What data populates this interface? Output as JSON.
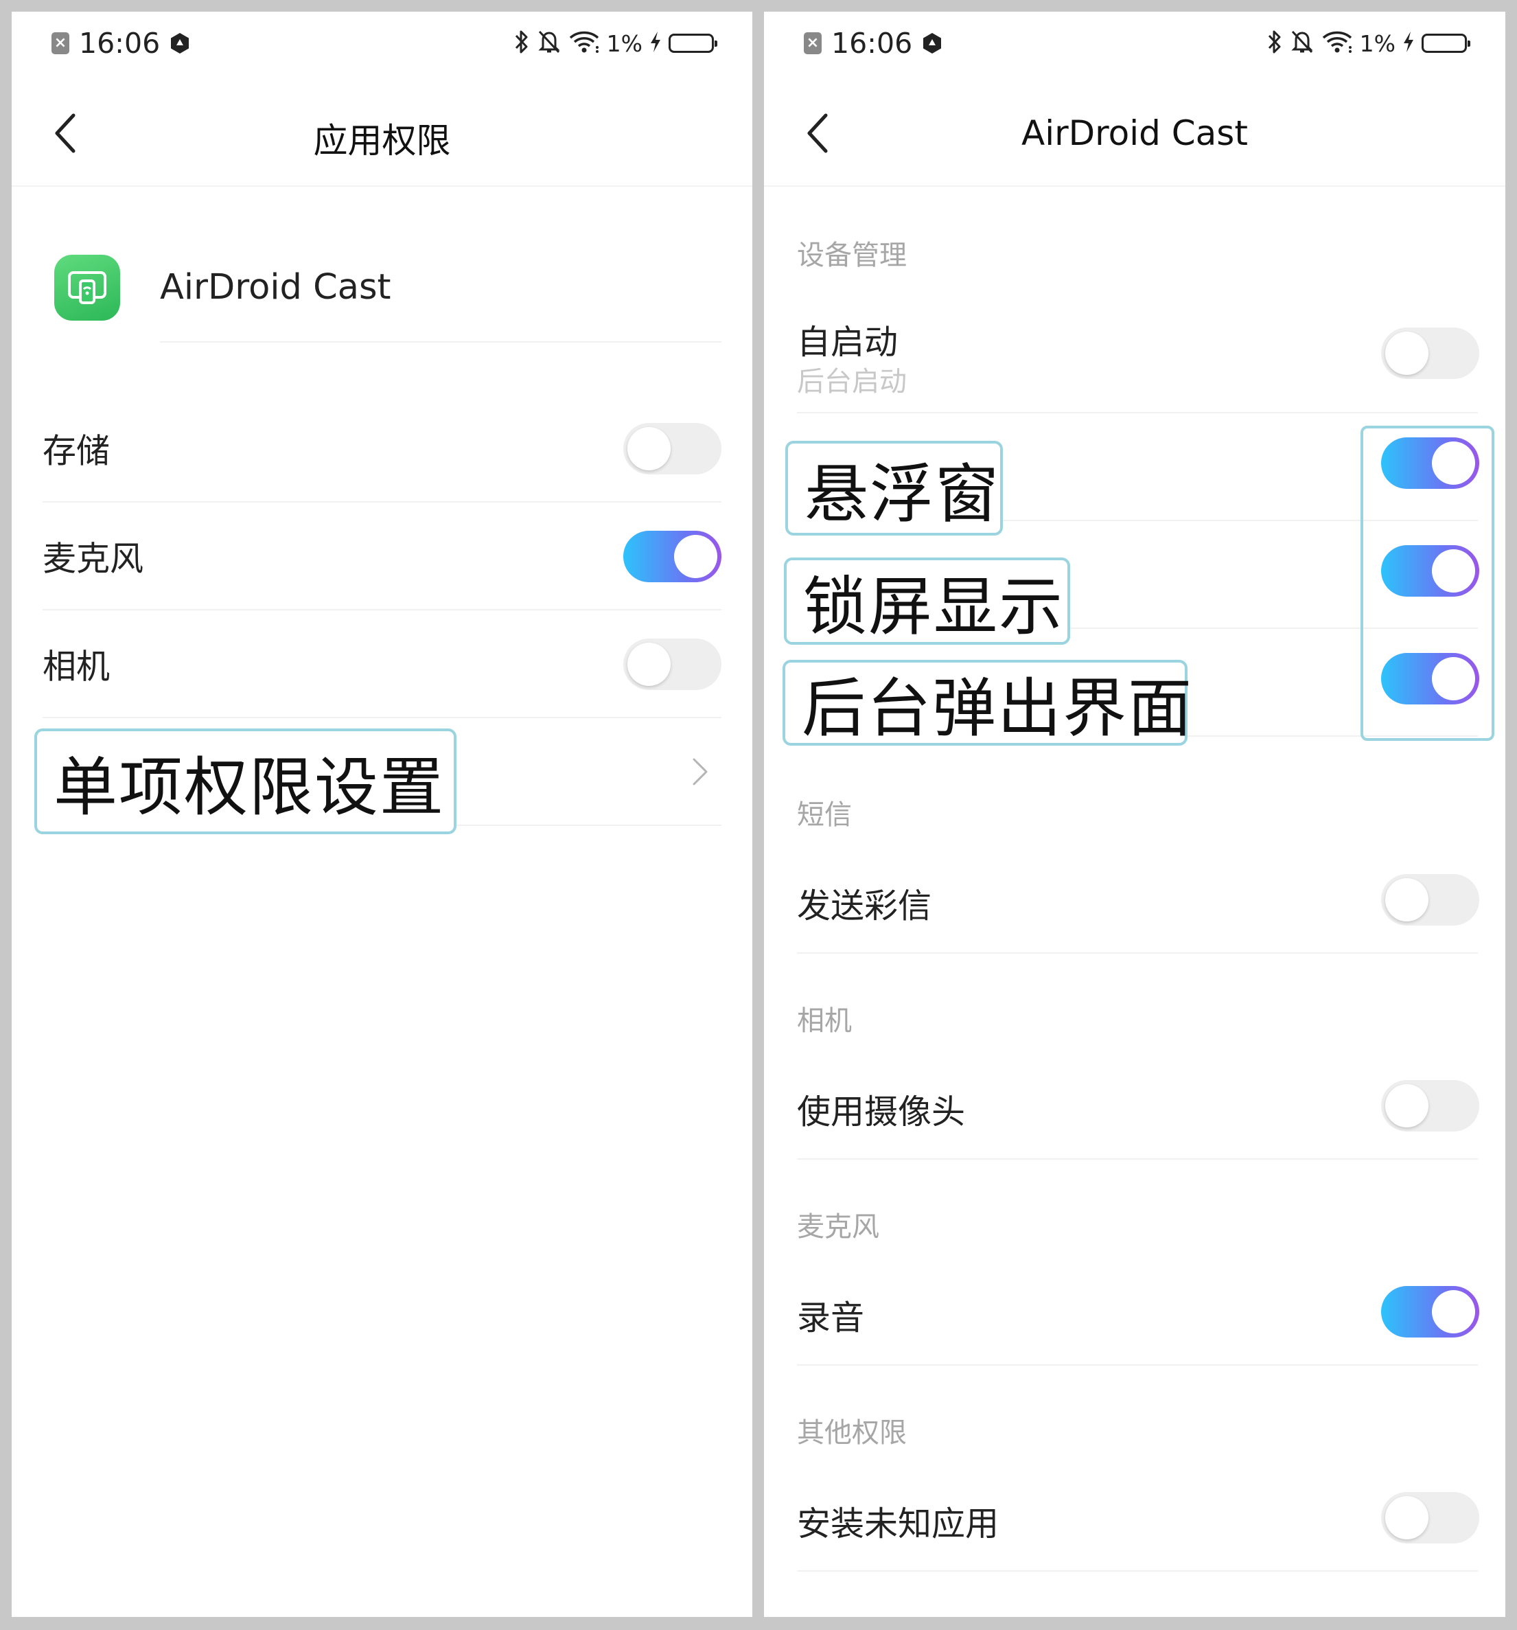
{
  "colors": {
    "toggle_on_gradient": [
      "#2dc3fb",
      "#6b75f4",
      "#9a56ea"
    ],
    "toggle_off": "#eeeeee",
    "callout_border": "#9ad4e0",
    "app_icon": "#3ec968",
    "section_header": "#a6a6a6",
    "background_gap": "#c8c8c8"
  },
  "left": {
    "status_bar": {
      "time": "16:06",
      "battery": "1%",
      "icons": [
        "sim-error-icon",
        "vpn-hex-icon",
        "bluetooth-icon",
        "mute-bell-icon",
        "wifi-icon",
        "charging-bolt-icon",
        "battery-icon"
      ]
    },
    "header": {
      "title": "应用权限",
      "back_icon": "chevron-left-icon"
    },
    "app": {
      "name": "AirDroid Cast",
      "icon": "airdroid-cast-app-icon"
    },
    "permissions": [
      {
        "label": "存储",
        "enabled": false
      },
      {
        "label": "麦克风",
        "enabled": true
      },
      {
        "label": "相机",
        "enabled": false
      }
    ],
    "detail_row": {
      "label": "单项权限设置",
      "icon": "chevron-right-icon"
    }
  },
  "right": {
    "status_bar": {
      "time": "16:06",
      "battery": "1%"
    },
    "header": {
      "title": "AirDroid Cast",
      "back_icon": "chevron-left-icon"
    },
    "sections": {
      "device": {
        "title": "设备管理",
        "autostart": {
          "label": "自启动",
          "sub": "后台启动",
          "enabled": false
        },
        "floating_window": {
          "label": "悬浮窗",
          "enabled": true
        },
        "lock_screen": {
          "label": "锁屏显示",
          "enabled": true
        },
        "background_popup": {
          "label": "后台弹出界面",
          "enabled": true
        }
      },
      "sms": {
        "title": "短信",
        "items": [
          {
            "label": "发送彩信",
            "enabled": false
          }
        ]
      },
      "camera": {
        "title": "相机",
        "items": [
          {
            "label": "使用摄像头",
            "enabled": false
          }
        ]
      },
      "microphone": {
        "title": "麦克风",
        "items": [
          {
            "label": "录音",
            "enabled": true
          }
        ]
      },
      "other": {
        "title": "其他权限",
        "items": [
          {
            "label": "安装未知应用",
            "enabled": false
          }
        ]
      }
    }
  }
}
